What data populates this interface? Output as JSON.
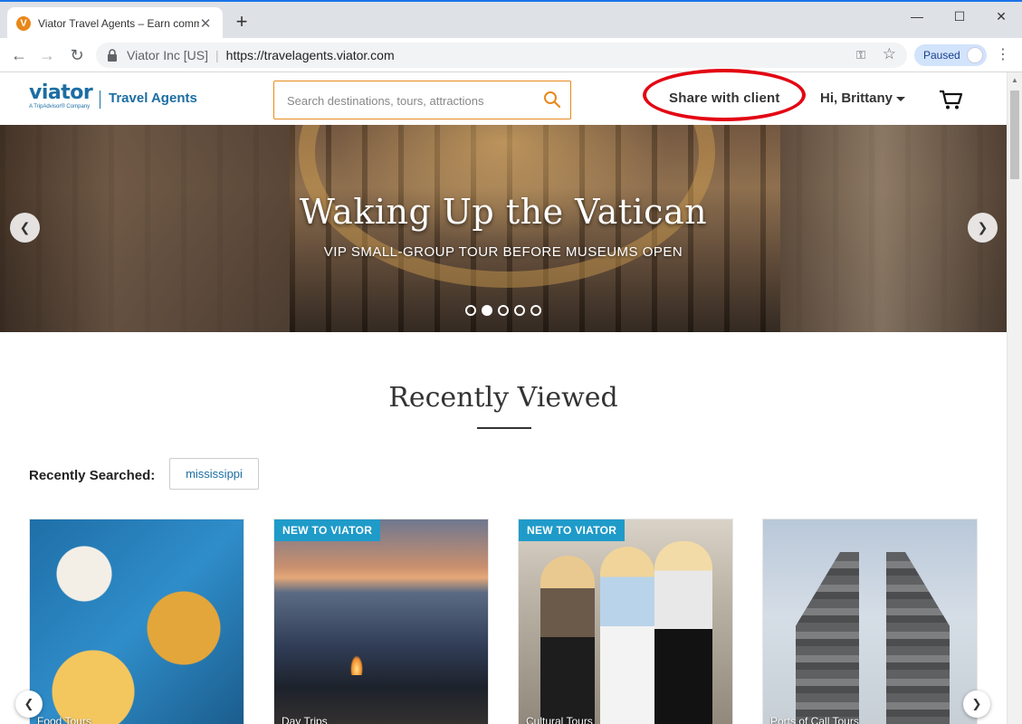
{
  "browser": {
    "tab_title": "Viator Travel Agents – Earn comm",
    "favicon_letter": "V",
    "new_tab": "+",
    "site_identity": "Viator Inc [US]",
    "url": "https://travelagents.viator.com",
    "profile_status": "Paused"
  },
  "header": {
    "logo_word": "viator",
    "logo_sub": "A TripAdvisor® Company",
    "logo_section": "Travel Agents",
    "search_placeholder": "Search destinations, tours, attractions",
    "share_label": "Share with client",
    "greeting": "Hi, Brittany",
    "accent_color": "#e8891f",
    "brand_color": "#1b6ea3",
    "annotation_color": "#e30613"
  },
  "hero": {
    "title": "Waking Up the Vatican",
    "subtitle": "VIP SMALL-GROUP TOUR BEFORE MUSEUMS OPEN",
    "slide_count": 5,
    "active_slide": 2
  },
  "recently_viewed": {
    "title": "Recently Viewed",
    "searched_label": "Recently Searched:",
    "searched_terms": [
      "mississippi"
    ],
    "cards": [
      {
        "badge": "",
        "label": "Food Tours"
      },
      {
        "badge": "NEW TO VIATOR",
        "label": "Day Trips"
      },
      {
        "badge": "NEW TO VIATOR",
        "label": "Cultural Tours"
      },
      {
        "badge": "",
        "label": "Ports of Call Tours"
      }
    ]
  }
}
